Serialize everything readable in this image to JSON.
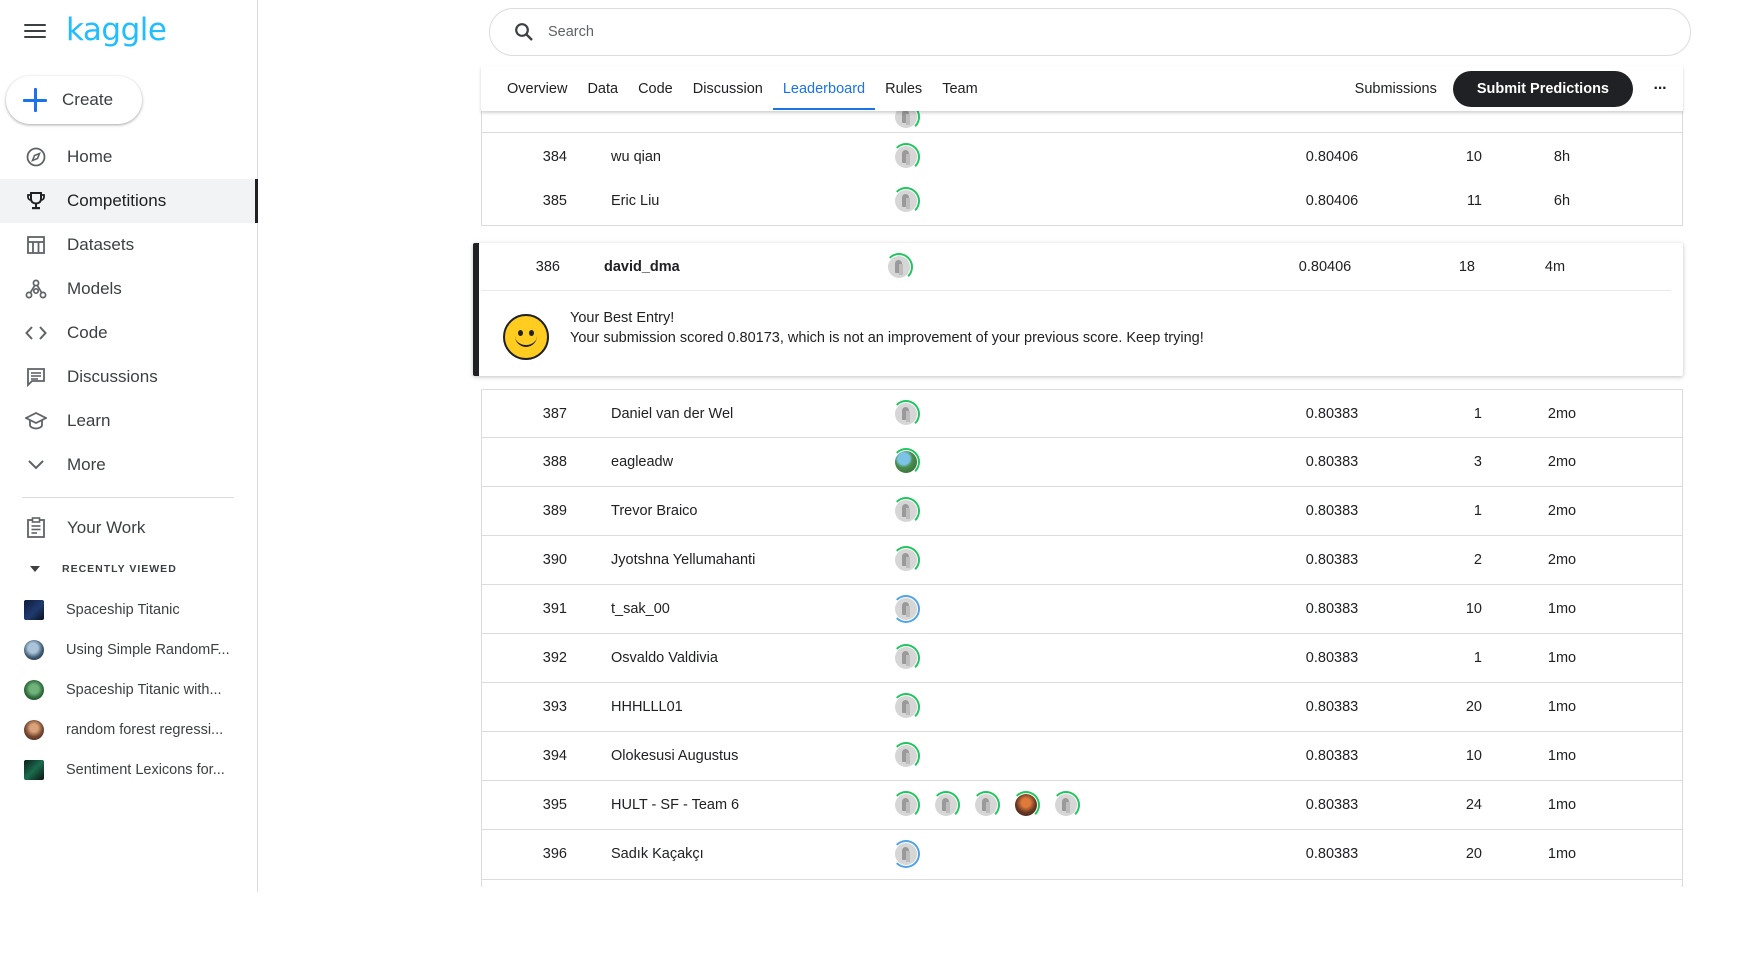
{
  "brand": {
    "logo_text": "kaggle",
    "accent": "#20beff"
  },
  "sidebar": {
    "create_label": "Create",
    "items": [
      {
        "label": "Home",
        "icon": "compass-icon"
      },
      {
        "label": "Competitions",
        "icon": "trophy-icon",
        "active": true
      },
      {
        "label": "Datasets",
        "icon": "table-icon"
      },
      {
        "label": "Models",
        "icon": "models-icon"
      },
      {
        "label": "Code",
        "icon": "code-icon"
      },
      {
        "label": "Discussions",
        "icon": "discussion-icon"
      },
      {
        "label": "Learn",
        "icon": "learn-icon"
      },
      {
        "label": "More",
        "icon": "chevron-down-icon"
      }
    ],
    "your_work": "Your Work",
    "recently_viewed_heading": "RECENTLY VIEWED",
    "recent": [
      "Spaceship Titanic",
      "Using Simple RandomF...",
      "Spaceship Titanic with...",
      "random forest regressi...",
      "Sentiment Lexicons for..."
    ]
  },
  "search": {
    "placeholder": "Search"
  },
  "tabs": [
    "Overview",
    "Data",
    "Code",
    "Discussion",
    "Leaderboard",
    "Rules",
    "Team"
  ],
  "active_tab": "Leaderboard",
  "actions": {
    "submissions": "Submissions",
    "submit": "Submit Predictions",
    "more": "···"
  },
  "leaderboard": {
    "rows_before": [
      {
        "rank": "384",
        "name": "wu qian",
        "score": "0.80406",
        "entries": "10",
        "last": "8h"
      },
      {
        "rank": "385",
        "name": "Eric Liu",
        "score": "0.80406",
        "entries": "11",
        "last": "6h"
      }
    ],
    "mine": {
      "rank": "386",
      "name": "david_dma",
      "score": "0.80406",
      "entries": "18",
      "last": "4m",
      "message_title": "Your Best Entry!",
      "message_body": "Your submission scored 0.80173, which is not an improvement of your previous score. Keep trying!"
    },
    "rows_after": [
      {
        "rank": "387",
        "name": "Daniel van der Wel",
        "score": "0.80383",
        "entries": "1",
        "last": "2mo"
      },
      {
        "rank": "388",
        "name": "eagleadw",
        "score": "0.80383",
        "entries": "3",
        "last": "2mo"
      },
      {
        "rank": "389",
        "name": "Trevor Braico",
        "score": "0.80383",
        "entries": "1",
        "last": "2mo"
      },
      {
        "rank": "390",
        "name": "Jyotshna Yellumahanti",
        "score": "0.80383",
        "entries": "2",
        "last": "2mo"
      },
      {
        "rank": "391",
        "name": "t_sak_00",
        "score": "0.80383",
        "entries": "10",
        "last": "1mo"
      },
      {
        "rank": "392",
        "name": "Osvaldo Valdivia",
        "score": "0.80383",
        "entries": "1",
        "last": "1mo"
      },
      {
        "rank": "393",
        "name": "HHHLLL01",
        "score": "0.80383",
        "entries": "20",
        "last": "1mo"
      },
      {
        "rank": "394",
        "name": "Olokesusi Augustus",
        "score": "0.80383",
        "entries": "10",
        "last": "1mo"
      },
      {
        "rank": "395",
        "name": "HULT - SF - Team 6",
        "score": "0.80383",
        "entries": "24",
        "last": "1mo"
      },
      {
        "rank": "396",
        "name": "Sadık Kaçakçı",
        "score": "0.80383",
        "entries": "20",
        "last": "1mo"
      }
    ]
  }
}
